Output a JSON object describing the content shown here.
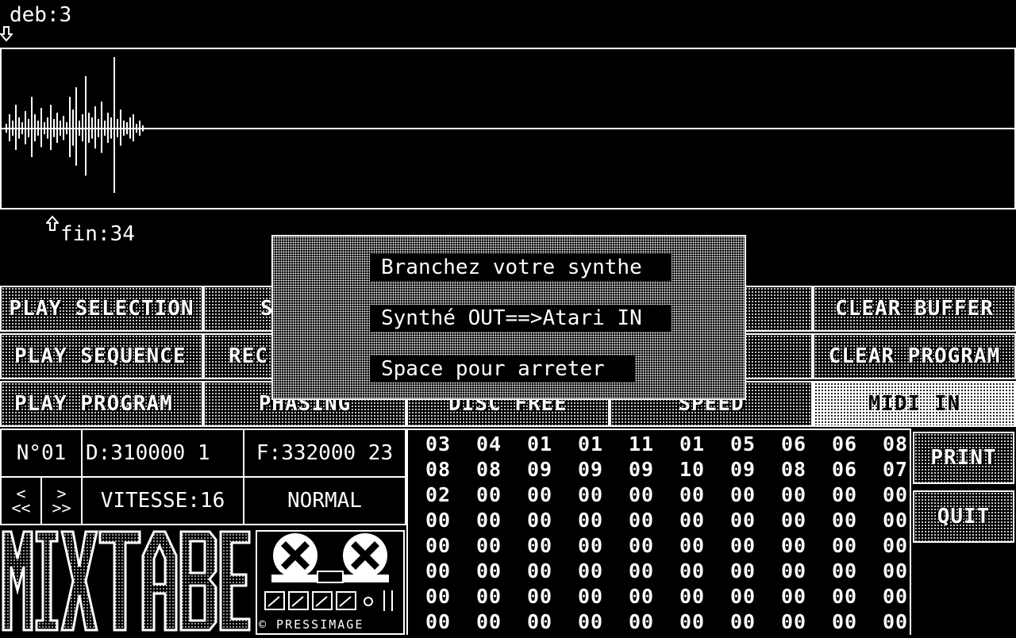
{
  "markers": {
    "start_label": "deb:3",
    "end_label": "fin:34"
  },
  "buttons": {
    "play_selection": "PLAY SELECTION",
    "play_sequence": "PLAY SEQUENCE",
    "play_program": "PLAY PROGRAM",
    "s_partial": "S",
    "rec_partial": "REC",
    "phasing": "PHASING",
    "disc_free": "DISC FREE",
    "speed": "SPEED",
    "clear_buffer": "CLEAR BUFFER",
    "clear_program": "CLEAR PROGRAM",
    "midi_in": "MIDI IN",
    "print": "PRINT",
    "quit": "QUIT"
  },
  "info": {
    "number": "N°01",
    "start": "D:310000 1",
    "finish": "F:332000 23",
    "prev_top": "<",
    "prev_bottom": "<<",
    "next_top": ">",
    "next_bottom": ">>",
    "speed": "VITESSE:16",
    "mode": "NORMAL"
  },
  "logo": {
    "text": "MIXTABLE",
    "copyright": "© PRESSIMAGE"
  },
  "dialog": {
    "line1": "Branchez votre synthe",
    "line2": "Synthé OUT==>Atari IN",
    "line3": "Space pour arreter"
  },
  "sequence_grid": [
    [
      "03",
      "04",
      "01",
      "01",
      "11",
      "01",
      "05",
      "06",
      "06",
      "08"
    ],
    [
      "08",
      "08",
      "09",
      "09",
      "09",
      "10",
      "09",
      "08",
      "06",
      "07"
    ],
    [
      "02",
      "00",
      "00",
      "00",
      "00",
      "00",
      "00",
      "00",
      "00",
      "00"
    ],
    [
      "00",
      "00",
      "00",
      "00",
      "00",
      "00",
      "00",
      "00",
      "00",
      "00"
    ],
    [
      "00",
      "00",
      "00",
      "00",
      "00",
      "00",
      "00",
      "00",
      "00",
      "00"
    ],
    [
      "00",
      "00",
      "00",
      "00",
      "00",
      "00",
      "00",
      "00",
      "00",
      "00"
    ],
    [
      "00",
      "00",
      "00",
      "00",
      "00",
      "00",
      "00",
      "00",
      "00",
      "00"
    ],
    [
      "00",
      "00",
      "00",
      "00",
      "00",
      "00",
      "00",
      "00",
      "00",
      "00"
    ]
  ],
  "icons": {
    "down_arrow": "down-arrow-icon",
    "up_arrow": "up-arrow-icon",
    "tape": "tape-recorder-icon"
  }
}
